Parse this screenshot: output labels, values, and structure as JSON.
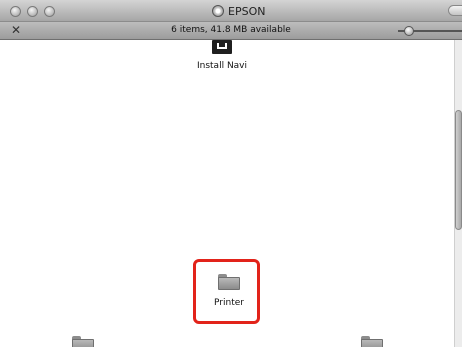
{
  "window": {
    "title": "EPSON",
    "status": "6 items, 41.8 MB available"
  },
  "items": {
    "install_navi": {
      "label": "Install Navi",
      "icon": "installer-icon"
    },
    "printer": {
      "label": "Printer",
      "icon": "folder-icon"
    }
  },
  "colors": {
    "highlight": "#e2231a"
  }
}
